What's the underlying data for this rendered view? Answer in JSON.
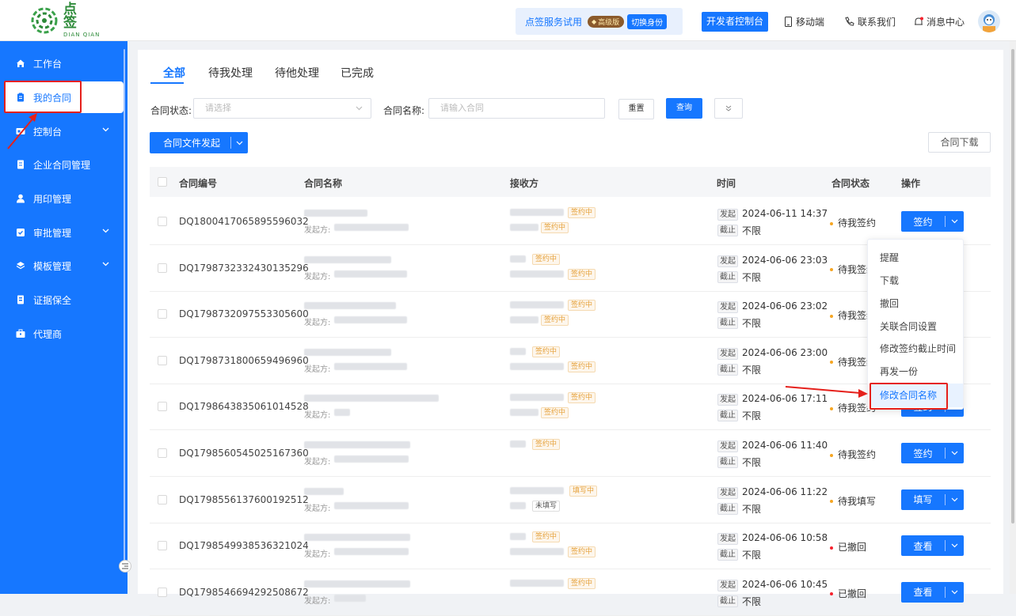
{
  "logo": {
    "cn": "点 签",
    "en": "DIAN QIAN"
  },
  "header": {
    "trial_text": "点签服务试用",
    "badge_text": "高级版",
    "switch_text": "切换身份",
    "dev_console": "开发者控制台",
    "mobile": "移动端",
    "contact": "联系我们",
    "messages": "消息中心"
  },
  "sidebar": {
    "items": [
      {
        "label": "工作台",
        "icon": "home-icon"
      },
      {
        "label": "我的合同",
        "icon": "clipboard-icon"
      },
      {
        "label": "控制台",
        "icon": "console-icon"
      },
      {
        "label": "企业合同管理",
        "icon": "document-icon"
      },
      {
        "label": "用印管理",
        "icon": "user-icon"
      },
      {
        "label": "审批管理",
        "icon": "check-icon"
      },
      {
        "label": "模板管理",
        "icon": "layers-icon"
      },
      {
        "label": "证据保全",
        "icon": "archive-icon"
      },
      {
        "label": "代理商",
        "icon": "briefcase-icon"
      }
    ]
  },
  "tabs": [
    "全部",
    "待我处理",
    "待他处理",
    "已完成"
  ],
  "filters": {
    "status_label": "合同状态:",
    "status_placeholder": "请选择",
    "name_label": "合同名称:",
    "name_placeholder": "请输入合同",
    "reset": "重置",
    "query": "查询"
  },
  "toolbar": {
    "send": "合同文件发起",
    "download": "合同下载"
  },
  "table": {
    "headers": [
      "合同编号",
      "合同名称",
      "接收方",
      "时间",
      "合同状态",
      "操作"
    ],
    "from_prefix": "发起方:",
    "start_tag": "发起",
    "end_tag": "截止",
    "rows": [
      {
        "id": "DQ1800417065895596032",
        "r1_status": "签约中",
        "r2_status": "签约中",
        "start": "2024-06-11 14:37",
        "end": "不限",
        "status": "待我签约",
        "status_color": "#f5a623",
        "action": "签约"
      },
      {
        "id": "DQ1798732332430135296",
        "r1_status": "签约中",
        "r2_status": "签约中",
        "start": "2024-06-06 23:03",
        "end": "不限",
        "status": "待我签约",
        "status_color": "#f5a623",
        "action": "签约"
      },
      {
        "id": "DQ1798732097553305600",
        "r1_status": "签约中",
        "r2_status": "签约中",
        "start": "2024-06-06 23:02",
        "end": "不限",
        "status": "待我签约",
        "status_color": "#f5a623",
        "action": "签约"
      },
      {
        "id": "DQ1798731800659496960",
        "r1_status": "签约中",
        "r2_status": "签约中",
        "start": "2024-06-06 23:00",
        "end": "不限",
        "status": "待我签约",
        "status_color": "#f5a623",
        "action": "签约"
      },
      {
        "id": "DQ1798643835061014528",
        "r1_status": "签约中",
        "r2_status": "签约中",
        "start": "2024-06-06 17:11",
        "end": "不限",
        "status": "待我签约",
        "status_color": "#f5a623",
        "action": "签约"
      },
      {
        "id": "DQ1798560545025167360",
        "r1_status": "签约中",
        "r2_status": "",
        "start": "2024-06-06 11:40",
        "end": "不限",
        "status": "待我签约",
        "status_color": "#f5a623",
        "action": "签约"
      },
      {
        "id": "DQ1798556137600192512",
        "r1_status": "填写中",
        "r2_status": "未填写",
        "start": "2024-06-06 11:22",
        "end": "不限",
        "status": "待我填写",
        "status_color": "#f5a623",
        "action": "填写"
      },
      {
        "id": "DQ1798549938536321024",
        "r1_status": "签约中",
        "r2_status": "签约中",
        "start": "2024-06-06 10:58",
        "end": "不限",
        "status": "已撤回",
        "status_color": "#f5222d",
        "action": "查看"
      },
      {
        "id": "DQ1798546694292508672",
        "r1_status": "签约中",
        "r2_status": "",
        "start": "2024-06-06 10:45",
        "end": "不限",
        "status": "已撤回",
        "status_color": "#f5222d",
        "action": "查看"
      }
    ]
  },
  "dropdown_menu": [
    "提醒",
    "下载",
    "撤回",
    "关联合同设置",
    "修改签约截止时间",
    "再发一份",
    "修改合同名称"
  ]
}
